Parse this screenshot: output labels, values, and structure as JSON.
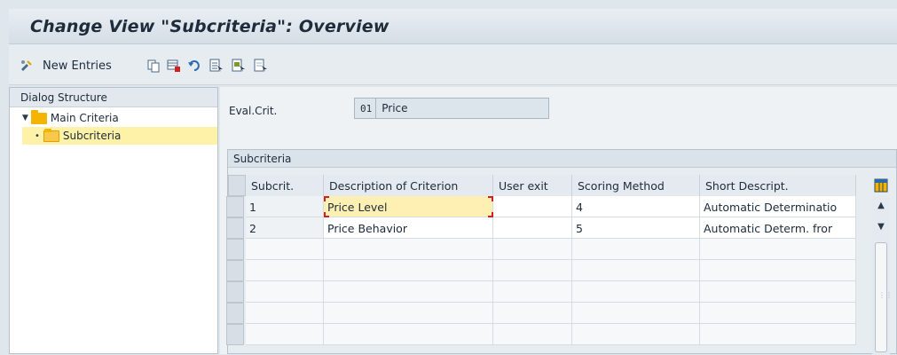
{
  "window": {
    "title": "Change View \"Subcriteria\": Overview"
  },
  "toolbar": {
    "new_entries_label": "New Entries",
    "icons": [
      "display-change-icon",
      "copy-icon",
      "delete-icon",
      "undo-icon",
      "select-all-icon",
      "select-block-icon",
      "deselect-all-icon"
    ]
  },
  "dialog_structure": {
    "header": "Dialog Structure",
    "items": [
      {
        "label": "Main Criteria",
        "level": 0,
        "expanded": true,
        "selected": false
      },
      {
        "label": "Subcriteria",
        "level": 1,
        "expanded": false,
        "selected": true
      }
    ]
  },
  "eval_crit": {
    "label": "Eval.Crit.",
    "code": "01",
    "text": "Price"
  },
  "table": {
    "caption": "Subcriteria",
    "columns": [
      "Subcrit.",
      "Description of Criterion",
      "User exit",
      "Scoring Method",
      "Short Descript."
    ],
    "rows": [
      [
        "1",
        "Price Level",
        "",
        "4",
        "Automatic Determinatio"
      ],
      [
        "2",
        "Price Behavior",
        "",
        "5",
        "Automatic Determ. fror"
      ]
    ],
    "empty_rows": 5
  },
  "colors": {
    "accent": "#f4b400",
    "selection": "#fdf2a8",
    "focus_border": "#d62020"
  }
}
